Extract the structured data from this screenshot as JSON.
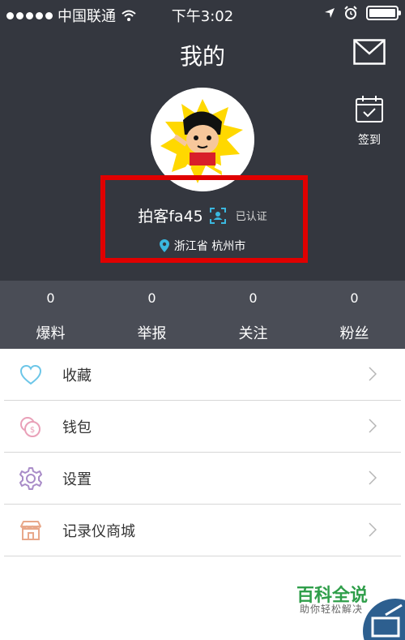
{
  "status": {
    "carrier": "中国联通",
    "time": "下午3:02"
  },
  "header": {
    "title": "我的",
    "signin_label": "签到"
  },
  "profile": {
    "username": "拍客fa45",
    "verified_label": "已认证",
    "location": "浙江省 杭州市"
  },
  "stats": [
    {
      "value": "0",
      "label": "爆料"
    },
    {
      "value": "0",
      "label": "举报"
    },
    {
      "value": "0",
      "label": "关注"
    },
    {
      "value": "0",
      "label": "粉丝"
    }
  ],
  "menu": [
    {
      "label": "收藏",
      "icon": "heart-icon"
    },
    {
      "label": "钱包",
      "icon": "wallet-icon"
    },
    {
      "label": "设置",
      "icon": "gear-icon"
    },
    {
      "label": "记录仪商城",
      "icon": "shop-icon"
    }
  ],
  "watermark": {
    "title": "百科全说",
    "subtitle": "助你轻松解决"
  }
}
